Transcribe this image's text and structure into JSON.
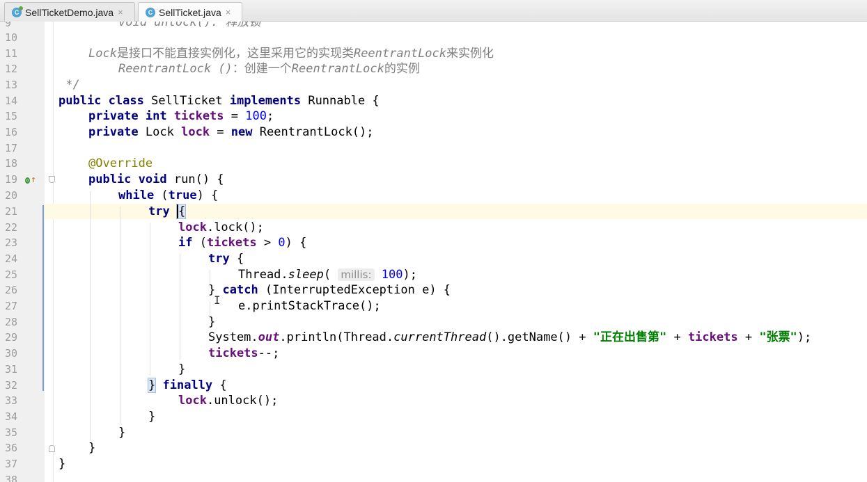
{
  "tabs": [
    {
      "label": "SellTicketDemo.java",
      "icon": "java-class-icon",
      "close": "×"
    },
    {
      "label": "SellTicket.java",
      "icon": "java-class-icon",
      "close": "×"
    }
  ],
  "editor": {
    "partial_top_line": "void unlock(): 释放锁",
    "line_numbers": [
      "10",
      "11",
      "12",
      "13",
      "14",
      "15",
      "16",
      "17",
      "18",
      "19",
      "20",
      "21",
      "22",
      "23",
      "24",
      "25",
      "26",
      "27",
      "28",
      "29",
      "30",
      "31",
      "32",
      "33",
      "34",
      "35",
      "36",
      "37",
      "38"
    ],
    "code": {
      "l11_a": "Lock",
      "l11_b": "是接口不能直接实例化，这里采用它的实现类",
      "l11_c": "ReentrantLock",
      "l11_d": "来实例化",
      "l12_a": "ReentrantLock ()",
      "l12_b": "：创建一个",
      "l12_c": "ReentrantLock",
      "l12_d": "的实例",
      "l13": " */",
      "kw_public": "public",
      "kw_class": "class",
      "cls_name": "SellTicket",
      "kw_implements": "implements",
      "iface": "Runnable {",
      "kw_private": "private",
      "kw_int": "int",
      "fld_tickets": "tickets",
      "eq": " = ",
      "num_100": "100",
      "semi": ";",
      "type_lock": "Lock",
      "fld_lock": "lock",
      "kw_new": "new",
      "ctor_call": "ReentrantLock();",
      "annotation": "@Override",
      "kw_void": "void",
      "run_sig": "run() {",
      "kw_while": "while",
      "paren_open": " (",
      "kw_true": "true",
      "paren_close_brace": ") {",
      "kw_try": "try",
      "brace_open": "{",
      "brace_close": "}",
      "lock_call": ".lock();",
      "kw_if": "if",
      "cond_rest": " > ",
      "num_0": "0",
      "cond_end": ") {",
      "thread": "Thread.",
      "sleep": "sleep",
      "sleep_open": "(",
      "hint_millis": "millis:",
      "sleep_close": ");",
      "kw_catch": "catch",
      "catch_rest": " (InterruptedException e) {",
      "print_trace": "e.printStackTrace();",
      "sys": "System.",
      "out": "out",
      "println_open": ".println(Thread.",
      "current_thread": "currentThread",
      "get_name": "().getName() + ",
      "str_selling": "\"正在出售第\"",
      "plus": " + ",
      "str_ticket": "\"张票\"",
      "print_end": ");",
      "decrement": "--;",
      "kw_finally": "finally",
      "brace_open_sp": " {",
      "unlock_call": ".unlock();"
    }
  },
  "colors": {
    "keyword": "#000080",
    "field": "#660e7a",
    "string": "#008000",
    "number": "#0000ff",
    "comment": "#808080",
    "annotation": "#808000",
    "caret_row": "#fffae3"
  }
}
